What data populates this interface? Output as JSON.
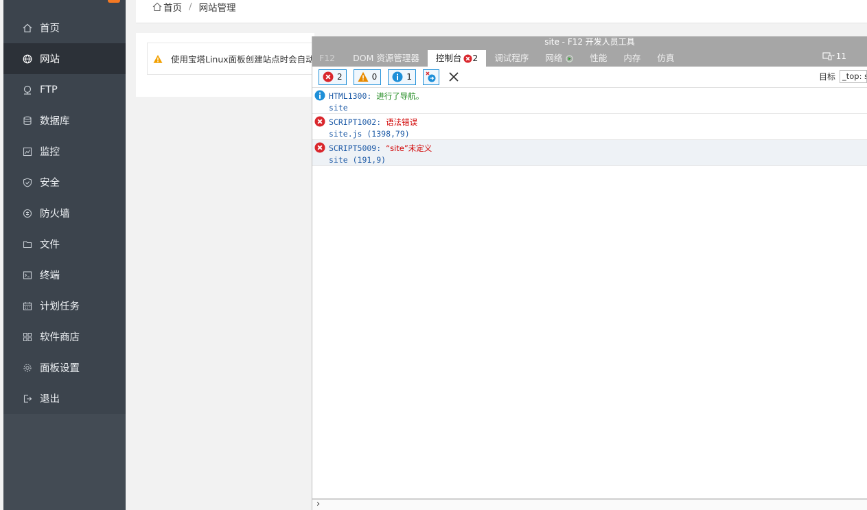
{
  "breadcrumb": {
    "home": "首页",
    "separator": "/",
    "current": "网站管理"
  },
  "sidebar": {
    "items": [
      {
        "label": "首页",
        "icon": "home-icon"
      },
      {
        "label": "网站",
        "icon": "globe-icon",
        "active": true
      },
      {
        "label": "FTP",
        "icon": "ftp-icon"
      },
      {
        "label": "数据库",
        "icon": "database-icon"
      },
      {
        "label": "监控",
        "icon": "monitor-icon"
      },
      {
        "label": "安全",
        "icon": "shield-icon"
      },
      {
        "label": "防火墙",
        "icon": "firewall-icon"
      },
      {
        "label": "文件",
        "icon": "folder-icon"
      },
      {
        "label": "终端",
        "icon": "terminal-icon"
      },
      {
        "label": "计划任务",
        "icon": "calendar-icon"
      },
      {
        "label": "软件商店",
        "icon": "apps-icon"
      },
      {
        "label": "面板设置",
        "icon": "gear-icon"
      },
      {
        "label": "退出",
        "icon": "logout-icon"
      }
    ]
  },
  "notice": {
    "text": "使用宝塔Linux面板创建站点时会自动创"
  },
  "devtools": {
    "title": "site - F12 开发人员工具",
    "tabs": [
      {
        "label": "F12",
        "faded": true
      },
      {
        "label": "DOM 资源管理器"
      },
      {
        "label": "控制台",
        "active": true,
        "badge": "2"
      },
      {
        "label": "调试程序"
      },
      {
        "label": "网络"
      },
      {
        "label": "性能"
      },
      {
        "label": "内存"
      },
      {
        "label": "仿真"
      }
    ],
    "device_count": "11",
    "toolbar": {
      "errors": "2",
      "warnings": "0",
      "infos": "1",
      "target_label": "目标",
      "target_value": "_top: site"
    },
    "messages": [
      {
        "type": "info",
        "code": "HTML1300",
        "sep": ": ",
        "text": "进行了导航。",
        "source": "site"
      },
      {
        "type": "error",
        "code": "SCRIPT1002",
        "sep": ": ",
        "text": "语法错误",
        "source": "site.js (1398,79)"
      },
      {
        "type": "error",
        "code": "SCRIPT5009",
        "sep": ": ",
        "text": "“site”未定义",
        "source": "site (191,9)",
        "highlighted": true
      }
    ],
    "prompt": "›"
  },
  "colors": {
    "sidebar_bg": "#3c444d",
    "sidebar_active": "#2c3138",
    "error": "#d9262c",
    "warning": "#e88a00",
    "info": "#1e8fd8"
  }
}
